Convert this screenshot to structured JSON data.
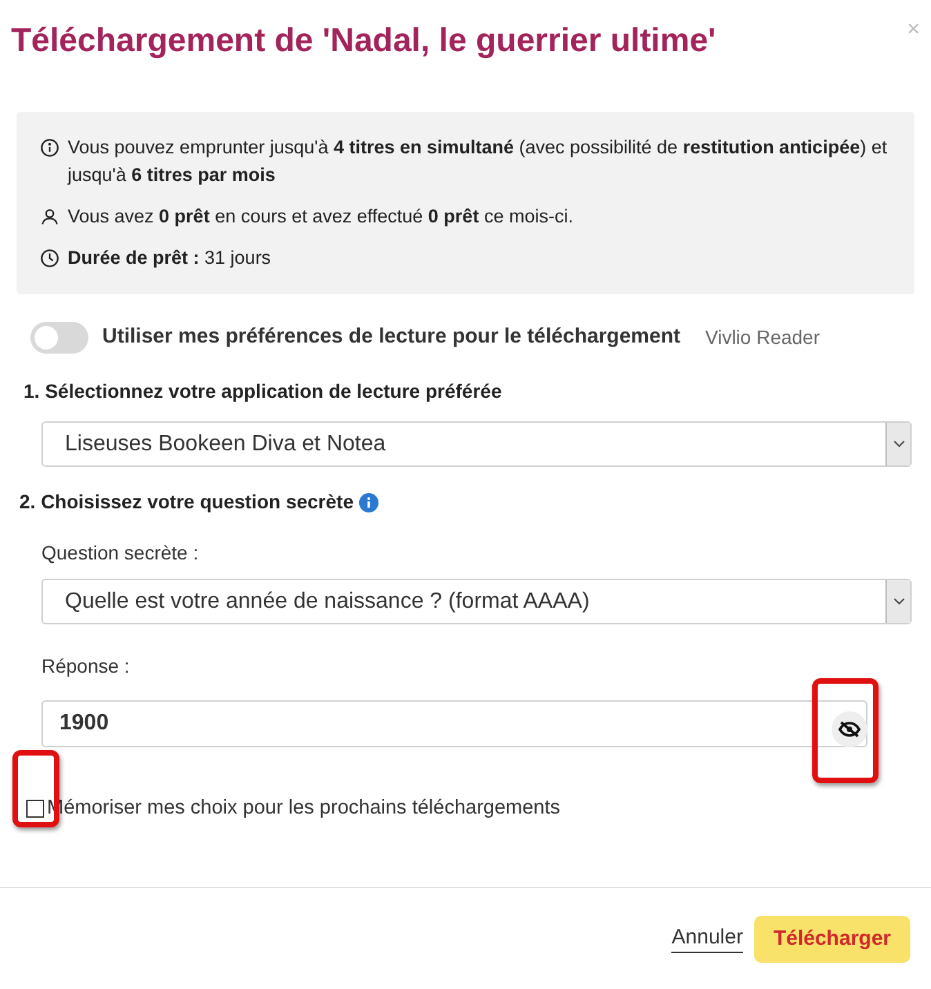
{
  "dialog": {
    "title": "Téléchargement de 'Nadal, le guerrier ultime'",
    "close": "×"
  },
  "info": [
    {
      "kind": "info",
      "text": "Vous pouvez emprunter jusqu'à **4 titres en simultané** (avec possibilité de **restitution anticipée**) et jusqu'à **6 titres par mois**"
    },
    {
      "kind": "user",
      "text": "Vous avez **0 prêt** en cours et avez effectué **0 prêt** ce mois-ci."
    },
    {
      "kind": "clock",
      "text": "**Durée de prêt :** 31 jours"
    }
  ],
  "preferences_toggle": {
    "label": "Utiliser mes préférences de lecture pour le téléchargement",
    "on": false,
    "app": "Vivlio Reader"
  },
  "step_1": {
    "heading": "1. Sélectionnez votre application de lecture préférée",
    "value": "Liseuses Bookeen Diva et Notea"
  },
  "step_2": {
    "heading": "2. Choisissez votre question secrète",
    "question_label": "Question secrète :",
    "question_value": "Quelle est votre année de naissance ? (format AAAA)",
    "answer_label": "Réponse :",
    "answer_value": "1900",
    "reveal_highlighted": true
  },
  "remember": {
    "label": "Mémoriser mes choix pour les prochains téléchargements",
    "checked": false,
    "highlighted": true
  },
  "buttons": [
    {
      "kind": "link",
      "label": "Annuler"
    },
    {
      "kind": "primary",
      "label": "Télécharger"
    }
  ]
}
